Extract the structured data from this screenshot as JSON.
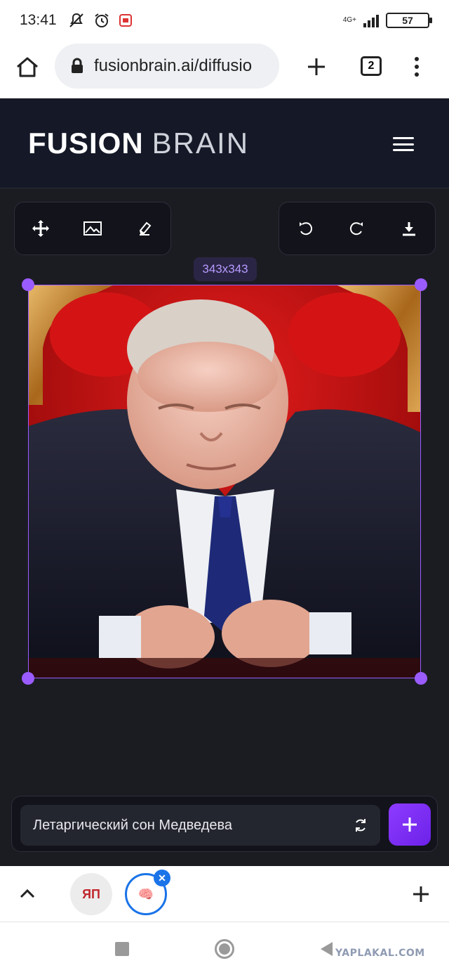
{
  "status_bar": {
    "time": "13:41",
    "network": "4G+",
    "battery": "57"
  },
  "browser": {
    "url": "fusionbrain.ai/diffusio",
    "tab_count": "2"
  },
  "site": {
    "logo_strong": "FUSION",
    "logo_light": "BRAIN"
  },
  "editor": {
    "image_size": "343x343",
    "tools_left": [
      "move-icon",
      "image-icon",
      "eraser-icon"
    ],
    "tools_right": [
      "undo-icon",
      "redo-icon",
      "download-icon"
    ]
  },
  "prompt": {
    "text": "Летаргический сон Медведева"
  },
  "tab_strip": {
    "tabs": [
      {
        "label": "ЯП",
        "active": false
      },
      {
        "label": "🧠",
        "active": true
      }
    ]
  },
  "watermark": "YAPLAKAL.COM",
  "colors": {
    "accent": "#9b5cff",
    "header_bg": "#141827",
    "page_bg": "#1b1c22"
  }
}
